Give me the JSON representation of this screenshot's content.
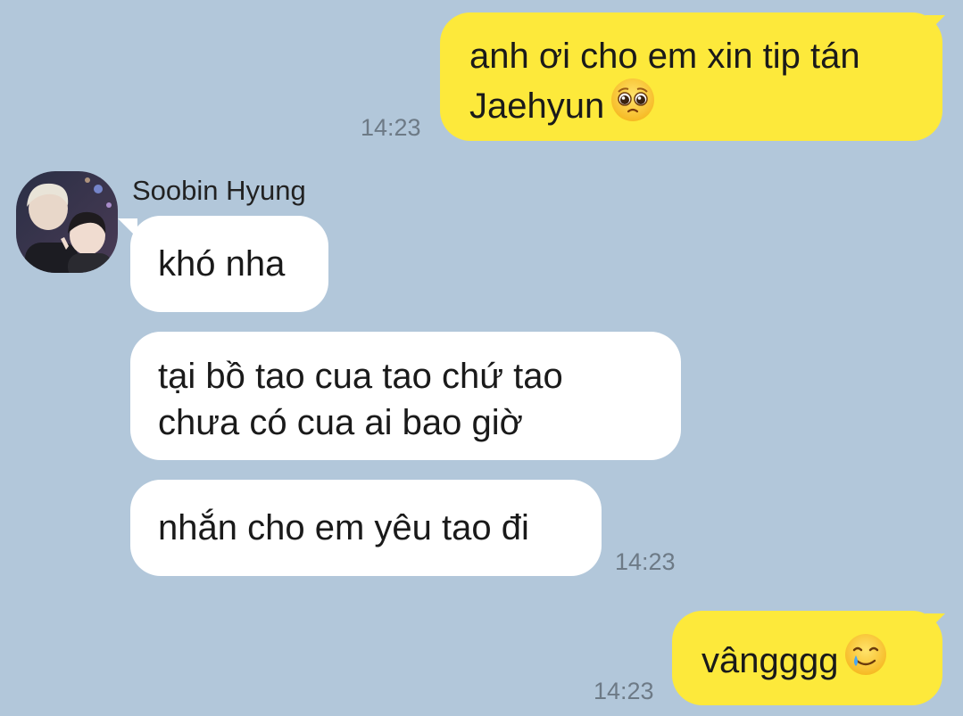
{
  "conversation": {
    "contact_name": "Soobin Hyung",
    "avatar_icon": "profile-photo-two-people",
    "colors": {
      "background": "#b2c7da",
      "outgoing_bubble": "#fde93b",
      "incoming_bubble": "#ffffff",
      "timestamp": "#6d7a86"
    },
    "messages": [
      {
        "direction": "outgoing",
        "line1": "anh ơi cho em xin tip tán",
        "line2": "Jaehyun",
        "emoji": "pleading-face-icon",
        "time": "14:23"
      },
      {
        "direction": "incoming",
        "text": "khó nha"
      },
      {
        "direction": "incoming",
        "line1": "tại bồ tao cua tao chứ tao",
        "line2": "chưa có cua ai bao giờ"
      },
      {
        "direction": "incoming",
        "text": "nhắn cho em yêu tao đi",
        "time": "14:23"
      },
      {
        "direction": "outgoing",
        "text": "vângggg",
        "emoji": "smiling-face-with-tear-icon",
        "time": "14:23"
      }
    ]
  }
}
